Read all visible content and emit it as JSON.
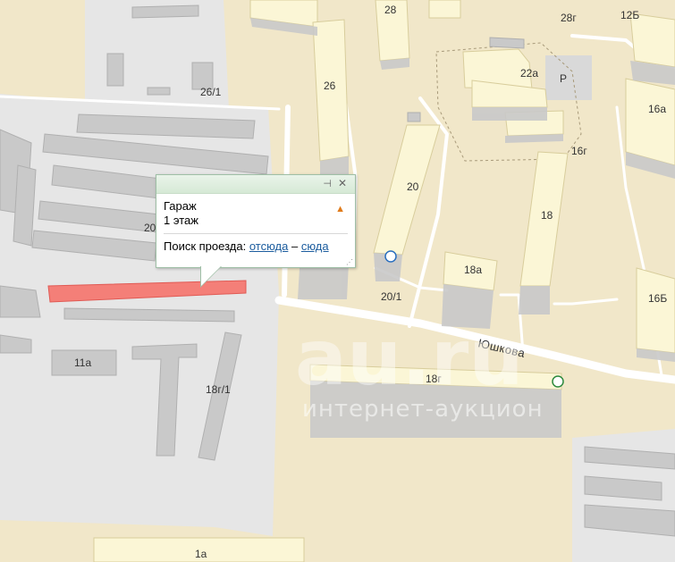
{
  "map": {
    "street_name": "Юшкова",
    "labels": {
      "b28": "28",
      "b28g": "28г",
      "b12b": "12Б",
      "b26": "26",
      "b26_1": "26/1",
      "b22a": "22а",
      "parking": "P",
      "b16a": "16а",
      "b16g": "16г",
      "b20": "20",
      "b18": "18",
      "b18a": "18а",
      "b16b": "16Б",
      "b20_1": "20/1",
      "b18g": "18г",
      "b11a": "11а",
      "b18g_1": "18г/1",
      "b1a": "1а",
      "b20_partial": "20"
    },
    "highlight_color": "#f47f78"
  },
  "watermark": {
    "main": "au.ru",
    "sub": "интернет-аукцион"
  },
  "popup": {
    "title": "Гараж",
    "floor": "1 этаж",
    "route_label": "Поиск проезда:",
    "from_link": "отсюда",
    "dash": "–",
    "to_link": "сюда"
  }
}
